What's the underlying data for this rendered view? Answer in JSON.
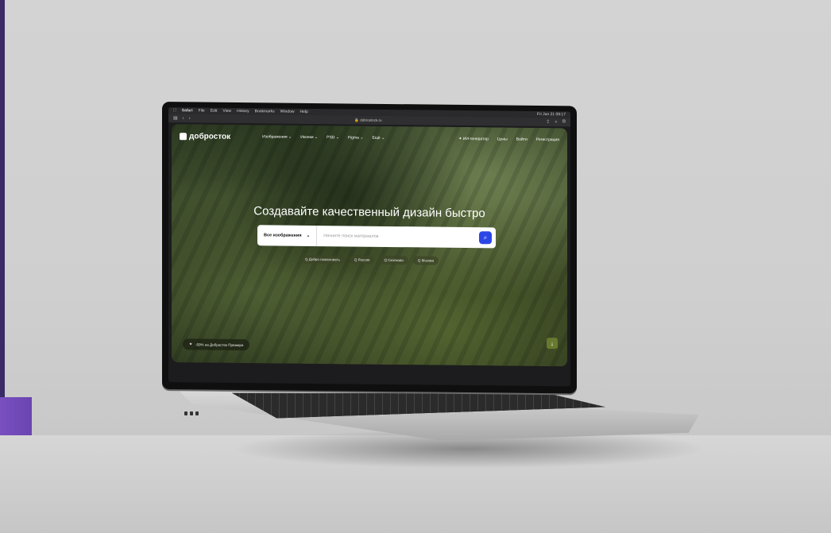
{
  "menubar": {
    "apple": "",
    "app": "Safari",
    "items": [
      "File",
      "Edit",
      "View",
      "History",
      "Bookmarks",
      "Window",
      "Help"
    ],
    "clock": "Fri Jun 21 09:17"
  },
  "browser": {
    "url": "dobrostock.ru"
  },
  "site": {
    "logo": "добросток",
    "nav": [
      "Изображения ⌄",
      "Иконки ⌄",
      "PSD ⌄",
      "Figma ⌄",
      "Ещё ⌄"
    ],
    "ai": "✦ ИИ-генератор",
    "prices": "Цены",
    "login": "Войти",
    "register": "Регистрация",
    "hero_title": "Создавайте качественный дизайн быстро",
    "search": {
      "scope": "Все изображения",
      "placeholder": "Начните поиск материалов"
    },
    "tags": [
      "Q Добро пожаловать",
      "Q Россия",
      "Q Сколково",
      "Q Москва"
    ],
    "promo": "-50% на Добросток Премиум"
  },
  "icon_names": [
    "apple-icon",
    "search-icon",
    "chevron-down-icon",
    "star-icon",
    "arrow-down-icon",
    "back-icon",
    "forward-icon",
    "sidebar-icon",
    "share-icon",
    "new-tab-icon",
    "tabs-icon",
    "lock-icon"
  ]
}
